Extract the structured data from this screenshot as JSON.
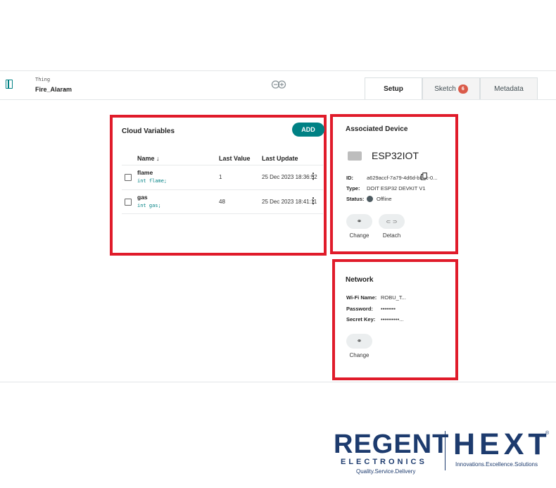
{
  "header": {
    "thing_label": "Thing",
    "thing_name": "Fire_Alaram",
    "tabs": [
      {
        "label": "Setup",
        "active": true
      },
      {
        "label": "Sketch",
        "badge": "6"
      },
      {
        "label": "Metadata"
      }
    ]
  },
  "cloud_variables": {
    "title": "Cloud Variables",
    "add_label": "ADD",
    "columns": {
      "name": "Name",
      "name_sort_icon": "↓",
      "last_value": "Last Value",
      "last_update": "Last Update"
    },
    "rows": [
      {
        "name": "flame",
        "declaration": "int flame;",
        "value": "1",
        "updated": "25 Dec 2023 18:36:52"
      },
      {
        "name": "gas",
        "declaration": "int gas;",
        "value": "48",
        "updated": "25 Dec 2023 18:41:11"
      }
    ]
  },
  "associated_device": {
    "title": "Associated Device",
    "device_name": "ESP32IOT",
    "id_key": "ID:",
    "id_value": "a629accf-7a79-4d6d-bb8c-0...",
    "type_key": "Type:",
    "type_value": "DOIT ESP32 DEVKIT V1",
    "status_key": "Status:",
    "status_value": "Offline",
    "change_label": "Change",
    "detach_label": "Detach",
    "change_glyph": "⚭",
    "detach_glyph": "⸦⸧"
  },
  "network": {
    "title": "Network",
    "wifi_key": "Wi-Fi Name:",
    "wifi_value": "ROBU_T...",
    "password_key": "Password:",
    "password_value": "••••••••",
    "secret_key": "Secret Key:",
    "secret_value": "••••••••••...",
    "change_label": "Change",
    "change_glyph": "⚭"
  },
  "watermark": {
    "regent": "REGENT",
    "electronics": "ELECTRONICS",
    "tagline_left": "Quality.Service.Delivery",
    "hext": "HEXT",
    "registered": "®",
    "tagline_right": "Innovations.Excellence.Solutions"
  },
  "colors": {
    "accent": "#008184",
    "highlight_border": "#e01b2a",
    "badge": "#da5b4a",
    "logo": "#1d3b6e"
  }
}
